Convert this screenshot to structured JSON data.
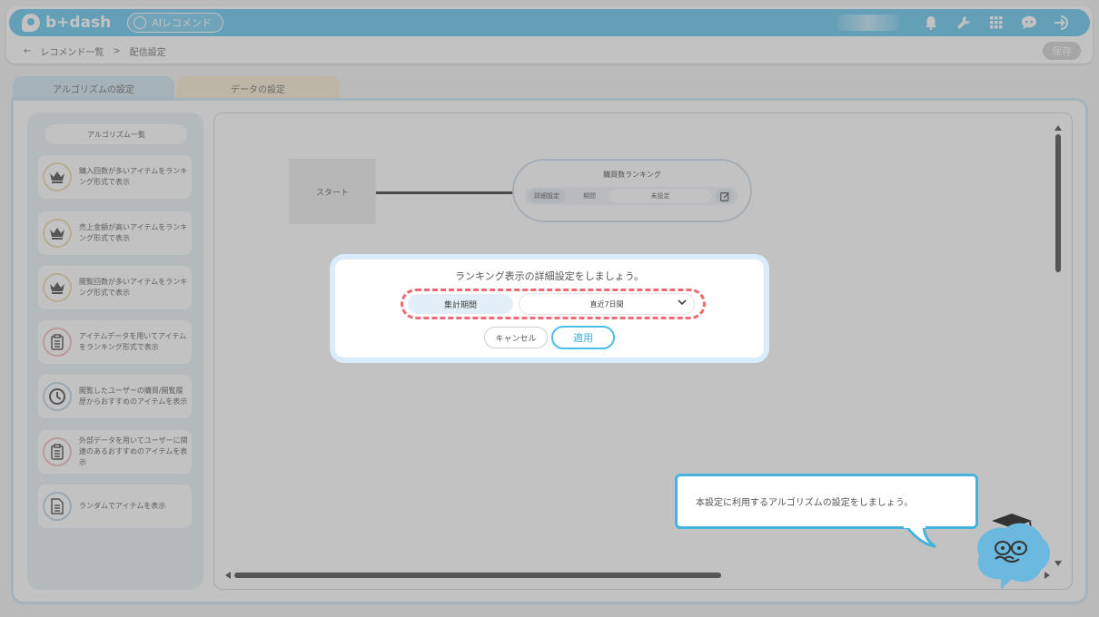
{
  "app": {
    "logo_text": "b+dash",
    "module_label": "AIレコメンド"
  },
  "breadcrumb": {
    "back_glyph": "←",
    "items": [
      "レコメンド一覧",
      "配信設定"
    ],
    "separator": ">"
  },
  "header": {
    "save_label": "保存"
  },
  "tabs": [
    {
      "label": "アルゴリズムの設定"
    },
    {
      "label": "データの設定"
    }
  ],
  "sidebar": {
    "title": "アルゴリズム一覧",
    "items": [
      {
        "text": "購入回数が多いアイテムをランキング形式で表示",
        "icon": "crown-icon"
      },
      {
        "text": "売上金額が高いアイテムをランキング形式で表示",
        "icon": "crown-icon"
      },
      {
        "text": "閲覧回数が多いアイテムをランキング形式で表示",
        "icon": "crown-icon"
      },
      {
        "text": "アイテムデータを用いてアイテムをランキング形式で表示",
        "icon": "clipboard-icon"
      },
      {
        "text": "閲覧したユーザーの購買/閲覧履歴からおすすめのアイテムを表示",
        "icon": "clock-icon"
      },
      {
        "text": "外部データを用いてユーザーに関連のあるおすすめのアイテムを表示",
        "icon": "clipboard-icon"
      },
      {
        "text": "ランダムでアイテムを表示",
        "icon": "document-icon"
      }
    ]
  },
  "canvas": {
    "start_node_label": "スタート",
    "ranking_node": {
      "title": "購買数ランキング",
      "chip_label": "詳細設定",
      "period_label": "期間",
      "period_value": "未設定"
    }
  },
  "modal": {
    "title": "ランキング表示の詳細設定をしましょう。",
    "field_label": "集計期間",
    "select_value": "直近7日間",
    "cancel_label": "キャンセル",
    "apply_label": "適用"
  },
  "guide": {
    "speech": "本設定に利用するアルゴリズムの設定をしましょう。"
  },
  "colors": {
    "brand": "#5ec3ee",
    "highlight_dashed": "#f06a73",
    "apply_border": "#4bbde8"
  }
}
